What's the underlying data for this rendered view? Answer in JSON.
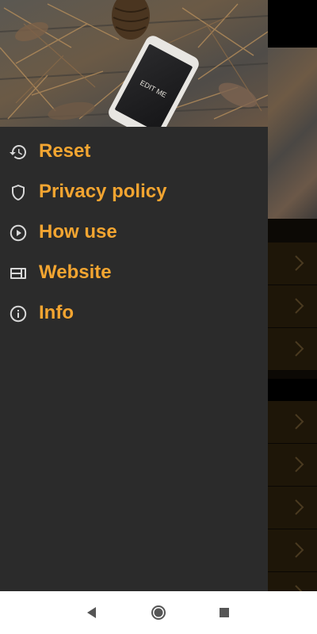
{
  "drawer": {
    "header_image": {
      "phone_screen_text": "EDIT ME"
    },
    "items": [
      {
        "label": "Reset",
        "icon": "history-icon"
      },
      {
        "label": "Privacy policy",
        "icon": "shield-icon"
      },
      {
        "label": "How use",
        "icon": "play-circle-icon"
      },
      {
        "label": "Website",
        "icon": "web-icon"
      },
      {
        "label": "Info",
        "icon": "info-icon"
      }
    ]
  },
  "navbar": {
    "buttons": [
      "back-icon",
      "home-icon",
      "recents-icon"
    ]
  },
  "colors": {
    "accent": "#f3a531",
    "drawer_bg": "#2b2b2b",
    "icon": "#d8d8d8"
  }
}
